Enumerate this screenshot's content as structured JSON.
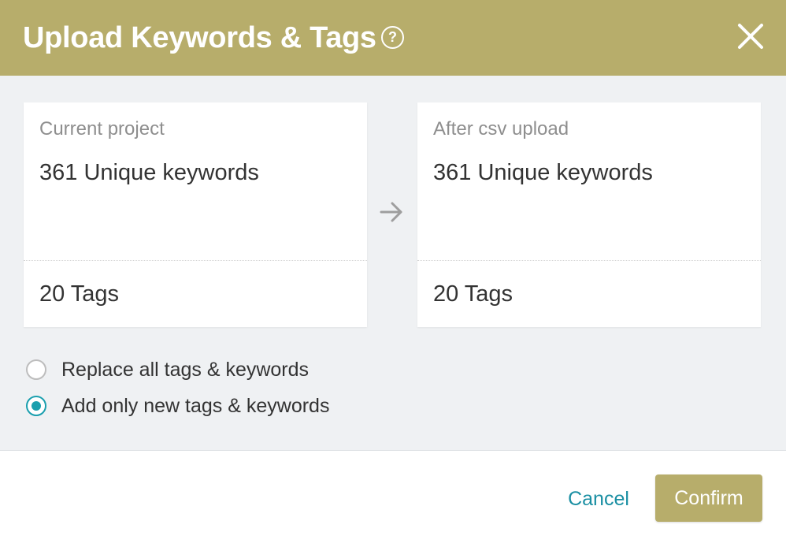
{
  "dialog": {
    "title": "Upload Keywords & Tags",
    "help_icon": "question-circle-icon",
    "help_glyph": "?",
    "close_icon": "close-icon",
    "accent_color": "#b7ad6b"
  },
  "comparison": {
    "current": {
      "label": "Current project",
      "keywords": "361 Unique keywords",
      "tags": "20 Tags"
    },
    "after": {
      "label": "After csv upload",
      "keywords": "361 Unique keywords",
      "tags": "20 Tags"
    },
    "arrow_icon": "arrow-right-icon"
  },
  "options": {
    "items": [
      {
        "label": "Replace all tags & keywords",
        "selected": false
      },
      {
        "label": "Add only new tags & keywords",
        "selected": true
      }
    ],
    "selected_color": "#1a9fae"
  },
  "footer": {
    "cancel_label": "Cancel",
    "confirm_label": "Confirm"
  }
}
